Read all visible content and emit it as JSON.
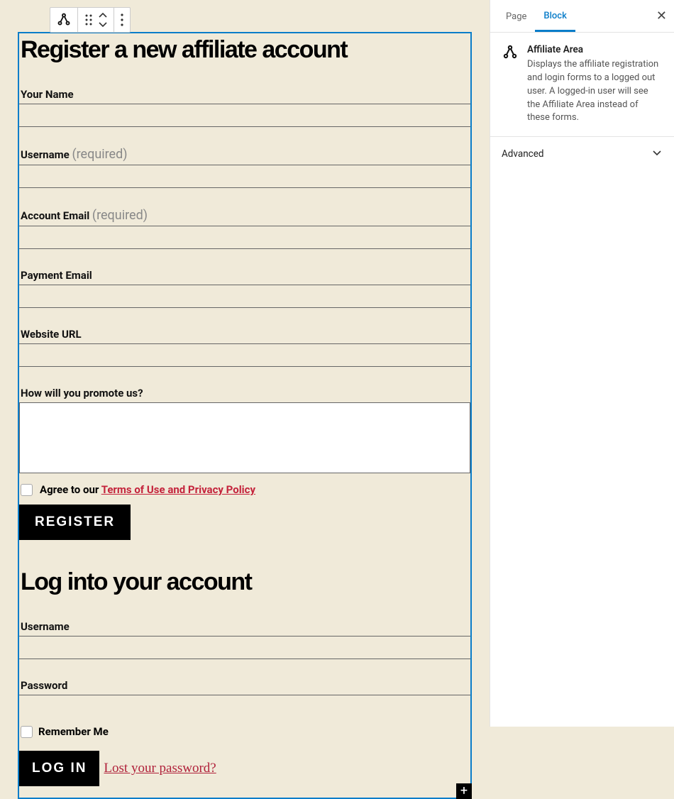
{
  "register": {
    "heading": "Register a new affiliate account",
    "fields": {
      "your_name": "Your Name",
      "username": "Username",
      "account_email": "Account Email",
      "payment_email": "Payment Email",
      "website_url": "Website URL",
      "promote": "How will you promote us?"
    },
    "required_label": "(required)",
    "agree_prefix": "Agree to our ",
    "terms_link": "Terms of Use and Privacy Policy",
    "button": "REGISTER"
  },
  "login": {
    "heading": "Log into your account",
    "fields": {
      "username": "Username",
      "password": "Password"
    },
    "remember": "Remember Me",
    "button": "LOG IN",
    "lost_password": "Lost your password?"
  },
  "sidebar": {
    "tabs": {
      "page": "Page",
      "block": "Block"
    },
    "block_title": "Affiliate Area",
    "block_desc": "Displays the affiliate registration and login forms to a logged out user. A logged-in user will see the Affiliate Area instead of these forms.",
    "advanced": "Advanced"
  }
}
